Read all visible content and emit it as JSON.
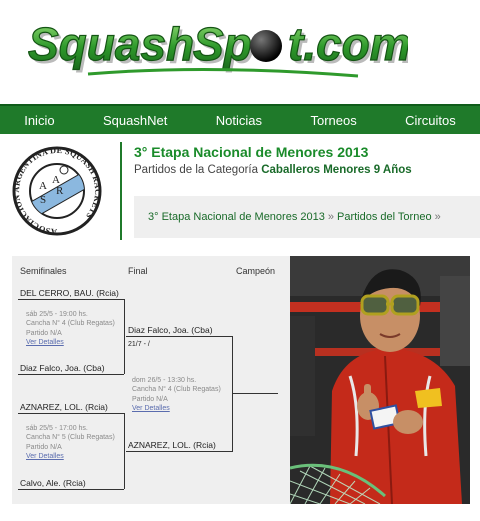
{
  "logo": {
    "part1": "Squash",
    "part2": "Sp",
    "part3": "t.com"
  },
  "nav": {
    "items": [
      "Inicio",
      "SquashNet",
      "Noticias",
      "Torneos",
      "Circuitos"
    ]
  },
  "association": {
    "circle_text": "ASOCIACION ARGENTINA DE SQUASH RACKETS",
    "letters": [
      "A",
      "A",
      "S",
      "R"
    ]
  },
  "header": {
    "title": "3° Etapa Nacional de Menores 2013",
    "subtitle_prefix": "Partidos de la Categoría",
    "category": "Caballeros Menores 9 Años"
  },
  "breadcrumb": {
    "items": [
      "3° Etapa Nacional de Menores 2013",
      "Partidos del Torneo"
    ],
    "separator": "»"
  },
  "bracket": {
    "headers": [
      "Semifinales",
      "Final",
      "Campeón"
    ],
    "semifinals": [
      {
        "top": "DEL CERRO, BAU. (Rcia)",
        "bottom": "Diaz Falco, Joa. (Cba)",
        "info": [
          "sáb 25/5 - 19:00 hs.",
          "Cancha N° 4 (Club Regatas)",
          "Partido N/A"
        ],
        "link": "Ver Detalles"
      },
      {
        "top": "AZNAREZ, LOL. (Rcia)",
        "bottom": "Calvo, Ale. (Rcia)",
        "info": [
          "sáb 25/5 - 17:00 hs.",
          "Cancha N° 5 (Club Regatas)",
          "Partido N/A"
        ],
        "link": "Ver Detalles"
      }
    ],
    "final": {
      "top": "Diaz Falco, Joa. (Cba)",
      "score": "21/7 - /",
      "bottom": "AZNAREZ, LOL. (Rcia)",
      "info": [
        "dom 26/5 - 13:30 hs.",
        "Cancha N° 4 (Club Regatas)",
        "Partido N/A"
      ],
      "link": "Ver Detalles"
    }
  },
  "colors": {
    "nav_green": "#1f7a2a",
    "title_green": "#1a8b2a",
    "link_blue": "#5a6cae"
  }
}
